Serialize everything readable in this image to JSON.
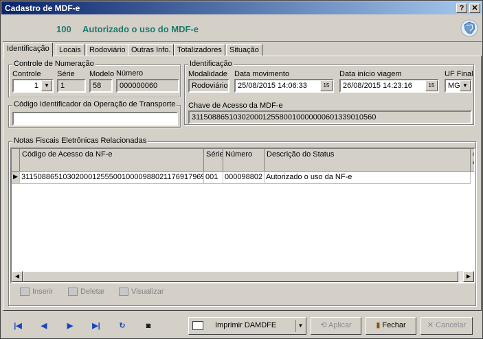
{
  "window": {
    "title": "Cadastro de MDF-e",
    "help_label": "?",
    "close_label": "✕"
  },
  "header": {
    "status_code": "100",
    "status_message": "Autorizado o uso do MDF-e",
    "logo_icon": "brazil-map-logo-icon"
  },
  "tabs": [
    {
      "label": "Identificação",
      "active": true
    },
    {
      "label": "Locais"
    },
    {
      "label": "Rodoviário"
    },
    {
      "label": "Outras Info."
    },
    {
      "label": "Totalizadores"
    },
    {
      "label": "Situação"
    }
  ],
  "numeracao": {
    "legend": "Controle de Numeração",
    "controle_label": "Controle",
    "controle_value": "1",
    "serie_label": "Série",
    "serie_value": "1",
    "modelo_label": "Modelo",
    "modelo_value": "58",
    "numero_label": "Número",
    "numero_value": "000000060"
  },
  "operacao": {
    "legend": "Código Identificador da Operação de Transporte",
    "value": ""
  },
  "identificacao": {
    "legend": "Identificação",
    "modalidade_label": "Modalidade",
    "modalidade_value": "Rodoviário",
    "data_mov_label": "Data movimento",
    "data_mov_value": "25/08/2015 14:06:33",
    "data_inicio_label": "Data início viagem",
    "data_inicio_value": "26/08/2015 14:23:16",
    "uf_label": "UF Final",
    "uf_value": "MG",
    "calendar_label": "15",
    "chave_label": "Chave de Acesso da MDF-e",
    "chave_value": "31150886510302000125580010000000601339010560"
  },
  "nfe": {
    "legend": "Notas Fiscais Eletrônicas Relacionadas",
    "columns": [
      "Código de Acesso da NF-e",
      "Série",
      "Número",
      "Descrição do Status",
      "o a"
    ],
    "rows": [
      [
        "31150886510302000125550010000988021176917969",
        "001",
        "000098802",
        "Autorizado o uso da NF-e"
      ]
    ],
    "toolbar": {
      "inserir": "Inserir",
      "deletar": "Deletar",
      "visualizar": "Visualizar"
    }
  },
  "footer": {
    "print_label": "Imprimir DAMDFE",
    "aplicar_label": "Aplicar",
    "fechar_label": "Fechar",
    "cancelar_label": "Cancelar"
  },
  "colors": {
    "status_teal": "#1c7a6b",
    "nav_blue": "#1a44c0",
    "title_blue": "#0a246a"
  }
}
